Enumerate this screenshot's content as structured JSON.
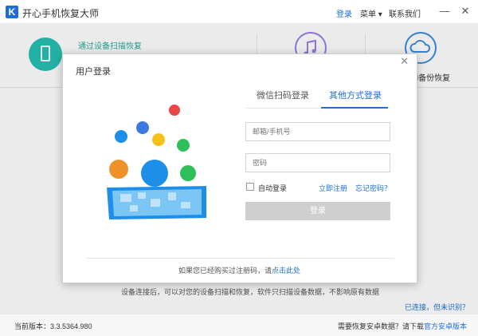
{
  "app": {
    "logo_letter": "K",
    "title": "开心手机恢复大师",
    "login": "登录",
    "menu": "菜单 ▾",
    "contact": "联系我们",
    "minimize": "—",
    "close": "✕"
  },
  "background": {
    "tile_device_label": "通过设备扫描恢复",
    "tile_icloud_label": "ud备份恢复",
    "hint": "设备连接后，可以对您的设备扫描和恢复，软件只扫描设备数据，不影响原有数据",
    "detect_link": "已连接，但未识别？"
  },
  "dialog": {
    "title": "用户登录",
    "close": "✕",
    "tabs": [
      {
        "label": "微信扫码登录",
        "active": false
      },
      {
        "label": "其他方式登录",
        "active": true
      }
    ],
    "email_placeholder": "邮箱/手机号",
    "password_placeholder": "密码",
    "auto_login": "自动登录",
    "register": "立即注册",
    "forgot": "忘记密码？",
    "login_button": "登录",
    "bottom_text": "如果您已经购买过注册码，请",
    "bottom_link": "点击此处"
  },
  "footer": {
    "version": "当前版本：3.3.5364.980",
    "android_text": "需要恢复安卓数据？请下载",
    "android_link": "官方安卓版本"
  },
  "colors": {
    "accent": "#1e6ed6",
    "teal": "#27c0b4",
    "button_disabled": "#cfcfcf"
  }
}
